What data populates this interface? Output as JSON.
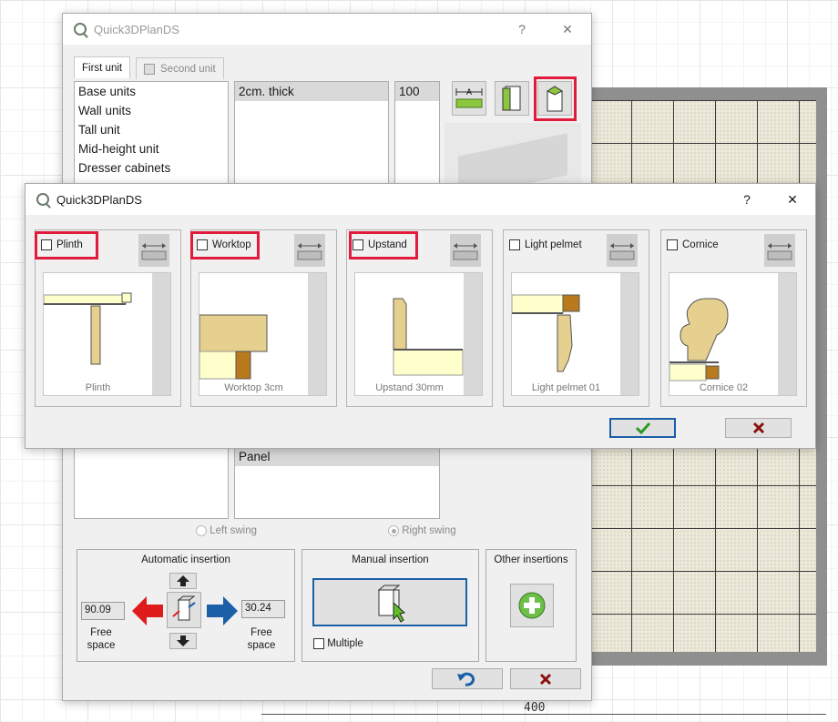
{
  "plan": {
    "dimension_label": "400"
  },
  "main_window": {
    "title": "Quick3DPlanDS",
    "help": "?",
    "close": "✕",
    "tabs": [
      {
        "label": "First unit",
        "active": true
      },
      {
        "label": "Second unit",
        "active": false
      }
    ],
    "categories": [
      "Base units",
      "Wall units",
      "Tall unit",
      "Mid-height unit",
      "Dresser cabinets"
    ],
    "thickness_list": [
      "2cm. thick"
    ],
    "value_list": [
      "100"
    ],
    "lower_list": [
      "Panel"
    ],
    "swing": {
      "left": "Left swing",
      "right": "Right swing",
      "selected": "right"
    },
    "automatic": {
      "title": "Automatic insertion",
      "left_value": "90.09",
      "right_value": "30.24",
      "free_space_left": "Free space",
      "free_space_right": "Free space"
    },
    "manual": {
      "title": "Manual insertion",
      "multiple": "Multiple"
    },
    "other": {
      "title": "Other insertions"
    }
  },
  "finish_dialog": {
    "title": "Quick3DPlanDS",
    "help": "?",
    "close": "✕",
    "panels": [
      {
        "label": "Plinth",
        "caption": "Plinth",
        "highlighted": true
      },
      {
        "label": "Worktop",
        "caption": "Worktop 3cm",
        "highlighted": true
      },
      {
        "label": "Upstand",
        "caption": "Upstand 30mm",
        "highlighted": true
      },
      {
        "label": "Light pelmet",
        "caption": "Light pelmet 01",
        "highlighted": false
      },
      {
        "label": "Cornice",
        "caption": "Cornice 02",
        "highlighted": false
      }
    ],
    "ok_icon": "check-icon",
    "cancel_icon": "x-icon"
  },
  "colors": {
    "highlight": "#e01b3c",
    "ok_border": "#1a5fa8",
    "wood": "#e6d08f",
    "dark_wood": "#b97a1e",
    "cream": "#ffffcc"
  }
}
